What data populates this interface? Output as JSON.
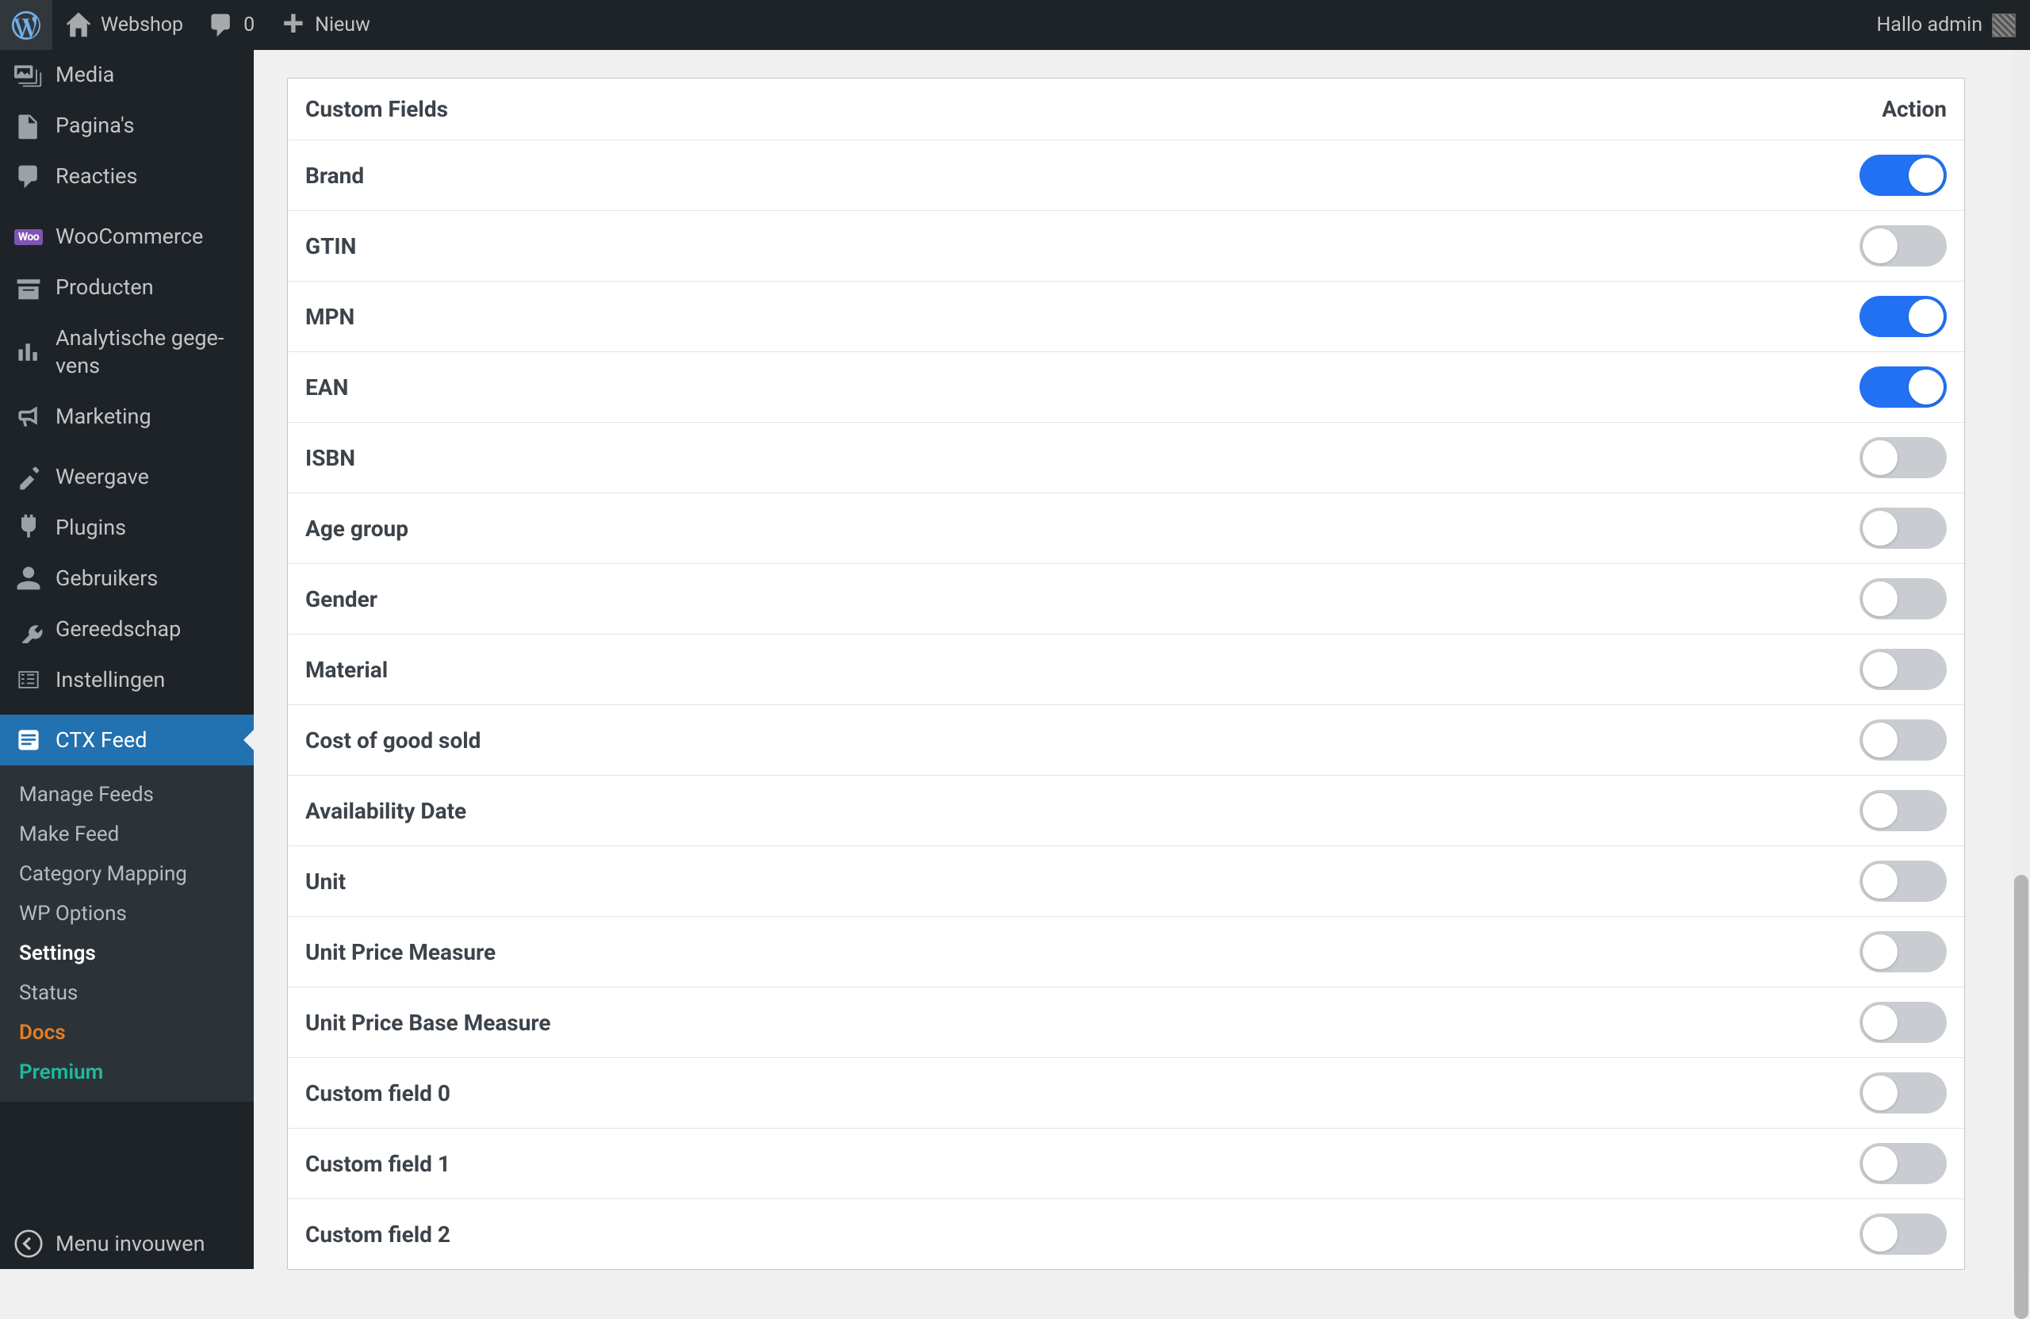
{
  "adminbar": {
    "site_name": "Webshop",
    "comments": "0",
    "new_label": "Nieuw",
    "greeting": "Hallo admin"
  },
  "sidebar": {
    "items": [
      {
        "id": "media",
        "label": "Media"
      },
      {
        "id": "pages",
        "label": "Pagina's"
      },
      {
        "id": "comments",
        "label": "Reacties"
      },
      {
        "id": "woocommerce",
        "label": "WooCommerce"
      },
      {
        "id": "products",
        "label": "Producten"
      },
      {
        "id": "analytics",
        "label": "Analytische gege­vens"
      },
      {
        "id": "marketing",
        "label": "Marketing"
      },
      {
        "id": "appearance",
        "label": "Weergave"
      },
      {
        "id": "plugins",
        "label": "Plugins"
      },
      {
        "id": "users",
        "label": "Gebruikers"
      },
      {
        "id": "tools",
        "label": "Gereedschap"
      },
      {
        "id": "settings",
        "label": "Instellingen"
      },
      {
        "id": "ctx-feed",
        "label": "CTX Feed",
        "active": true
      }
    ],
    "submenu": [
      {
        "label": "Manage Feeds"
      },
      {
        "label": "Make Feed"
      },
      {
        "label": "Category Mapping"
      },
      {
        "label": "WP Options"
      },
      {
        "label": "Settings",
        "current": true
      },
      {
        "label": "Status"
      },
      {
        "label": "Docs",
        "class": "docs"
      },
      {
        "label": "Premium",
        "class": "premium"
      }
    ],
    "collapse": "Menu invouwen"
  },
  "panel": {
    "title": "Custom Fields",
    "action_header": "Action",
    "fields": [
      {
        "label": "Brand",
        "on": true
      },
      {
        "label": "GTIN",
        "on": false
      },
      {
        "label": "MPN",
        "on": true
      },
      {
        "label": "EAN",
        "on": true
      },
      {
        "label": "ISBN",
        "on": false
      },
      {
        "label": "Age group",
        "on": false
      },
      {
        "label": "Gender",
        "on": false
      },
      {
        "label": "Material",
        "on": false
      },
      {
        "label": "Cost of good sold",
        "on": false
      },
      {
        "label": "Availability Date",
        "on": false
      },
      {
        "label": "Unit",
        "on": false
      },
      {
        "label": "Unit Price Measure",
        "on": false
      },
      {
        "label": "Unit Price Base Measure",
        "on": false
      },
      {
        "label": "Custom field 0",
        "on": false
      },
      {
        "label": "Custom field 1",
        "on": false
      },
      {
        "label": "Custom field 2",
        "on": false
      }
    ]
  }
}
